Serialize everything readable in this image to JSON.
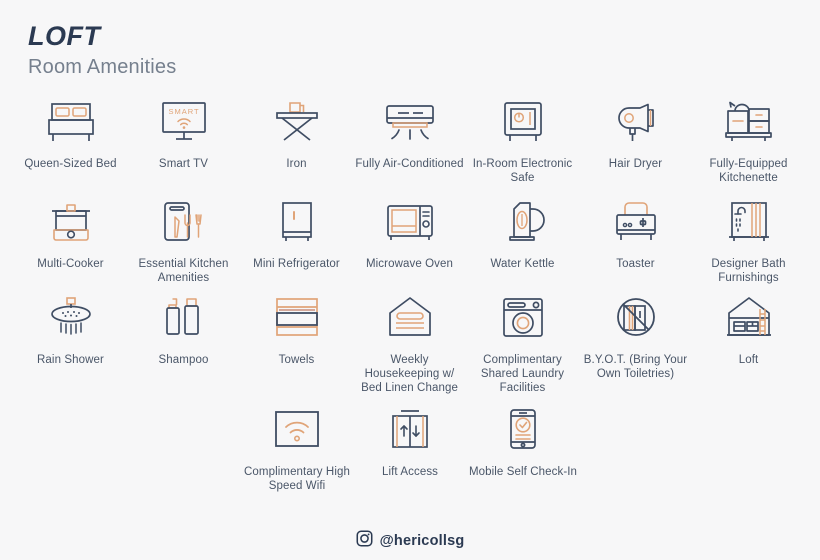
{
  "header": {
    "brand": "LOFT",
    "subtitle": "Room Amenities"
  },
  "colors": {
    "background": "#f7f7f8",
    "navy": "#3f4d63",
    "navy_dark": "#2b3a52",
    "orange": "#e0a478",
    "orange_light": "#f0d3ba",
    "label_text": "#4a5668",
    "subtitle_text": "#76808e"
  },
  "amenities": {
    "row1": [
      {
        "icon": "bed-icon",
        "label": "Queen-Sized Bed"
      },
      {
        "icon": "smart-tv-icon",
        "label": "Smart TV"
      },
      {
        "icon": "iron-icon",
        "label": "Iron"
      },
      {
        "icon": "air-conditioner-icon",
        "label": "Fully Air-Conditioned"
      },
      {
        "icon": "safe-icon",
        "label": "In-Room Electronic Safe"
      },
      {
        "icon": "hair-dryer-icon",
        "label": "Hair Dryer"
      },
      {
        "icon": "kitchenette-icon",
        "label": "Fully-Equipped Kitchenette"
      }
    ],
    "row2": [
      {
        "icon": "multi-cooker-icon",
        "label": "Multi-Cooker"
      },
      {
        "icon": "kitchen-utensils-icon",
        "label": "Essential Kitchen Amenities"
      },
      {
        "icon": "refrigerator-icon",
        "label": "Mini Refrigerator"
      },
      {
        "icon": "microwave-icon",
        "label": "Microwave Oven"
      },
      {
        "icon": "water-kettle-icon",
        "label": "Water Kettle"
      },
      {
        "icon": "toaster-icon",
        "label": "Toaster"
      },
      {
        "icon": "bath-furnishings-icon",
        "label": "Designer Bath Furnishings"
      }
    ],
    "row3": [
      {
        "icon": "rain-shower-icon",
        "label": "Rain Shower"
      },
      {
        "icon": "shampoo-icon",
        "label": "Shampoo"
      },
      {
        "icon": "towels-icon",
        "label": "Towels"
      },
      {
        "icon": "housekeeping-icon",
        "label": "Weekly Housekeeping w/ Bed Linen Change"
      },
      {
        "icon": "laundry-icon",
        "label": "Complimentary Shared Laundry Facilities"
      },
      {
        "icon": "no-toiletries-icon",
        "label": "B.Y.O.T. (Bring Your Own Toiletries)"
      },
      {
        "icon": "loft-icon",
        "label": "Loft"
      }
    ],
    "row4": [
      {
        "icon": "wifi-icon",
        "label": "Complimentary High Speed Wifi"
      },
      {
        "icon": "lift-icon",
        "label": "Lift Access"
      },
      {
        "icon": "mobile-checkin-icon",
        "label": "Mobile Self Check-In"
      }
    ]
  },
  "footer": {
    "icon": "instagram-icon",
    "handle": "@hericollsg"
  }
}
